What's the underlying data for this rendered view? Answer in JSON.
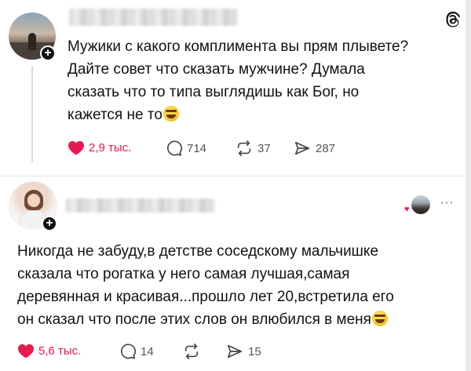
{
  "post1": {
    "text_lines": [
      "Мужики с какого комплимента вы прям плывете?",
      "Дайте совет что сказать мужчине? Думала",
      "сказать что то типа выглядишь как Бог, но",
      "кажется не то"
    ],
    "likes": "2,9 тыс.",
    "comments": "714",
    "reposts": "37",
    "shares": "287"
  },
  "post2": {
    "text_lines": [
      "Никогда не забуду,в детстве соседскому мальчишке",
      "сказала что рогатка у него самая лучшая,самая",
      "деревянная и красивая...прошло лет 20,встретила его",
      "он сказал что после этих слов он влюбился в меня"
    ],
    "likes": "5,6 тыс.",
    "comments": "14",
    "shares": "15"
  },
  "icons": {
    "logo": "threads-logo-icon",
    "like": "heart-icon",
    "comment": "comment-bubble-icon",
    "repost": "repost-icon",
    "share": "send-icon",
    "more": "more-icon"
  },
  "colors": {
    "like_red": "#e8194c",
    "icon_gray": "#555555"
  }
}
